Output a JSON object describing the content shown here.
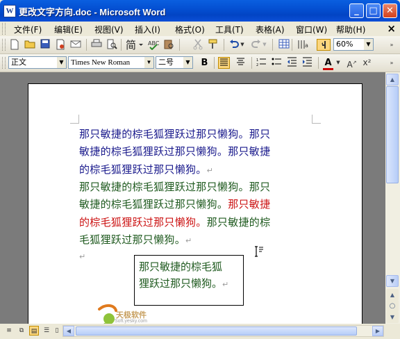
{
  "window": {
    "title": "更改文字方向.doc - Microsoft Word",
    "app_icon_label": "W",
    "minimize_glyph": "_",
    "maximize_glyph": "□",
    "close_glyph": "✕"
  },
  "menu": {
    "items": [
      "文件(F)",
      "编辑(E)",
      "视图(V)",
      "插入(I)",
      "格式(O)",
      "工具(T)",
      "表格(A)",
      "窗口(W)",
      "帮助(H)"
    ],
    "close_glyph": "×"
  },
  "standard_toolbar": {
    "zoom": "60%",
    "icons": [
      "new-icon",
      "open-icon",
      "save-icon",
      "permission-icon",
      "email-icon",
      "print-icon",
      "print-preview-icon",
      "research-icon",
      "spelling-icon",
      "cut-icon",
      "format-painter-icon",
      "undo-icon",
      "redo-icon",
      "table-icon",
      "columns-icon",
      "show-hide-icon"
    ]
  },
  "formatting_toolbar": {
    "style": "正文",
    "font": "Times New Roman",
    "size": "二号",
    "bold": "B",
    "font_color_label": "A",
    "font_color": "#cc0000",
    "grow_label": "A",
    "superscript_label": "x²"
  },
  "document": {
    "paragraph1": [
      "那只敏捷的棕毛狐狸跃过那只懒狗。那只",
      "敏捷的棕毛狐狸跃过那只懒狗。那只敏捷",
      "的棕毛狐狸跃过那只懒狗。"
    ],
    "paragraph2": {
      "line1": "那只敏捷的棕毛狐狸跃过那只懒狗。那只",
      "line2_normal": "敏捷的棕毛狐狸跃过那只懒狗。",
      "line2_red": "那只敏捷",
      "line3_red": "的棕毛狐狸跃过那只懒狗。",
      "line3_normal": "那只敏捷的棕",
      "line4": "毛狐狸跃过那只懒狗。"
    },
    "paragraph_mark": "↵",
    "textbox_lines": [
      "那只敏捷的棕毛狐",
      "狸跃过那只懒狗。"
    ],
    "colors": {
      "blue_text": "#1a1a8c",
      "green_text": "#1f5a1f",
      "red_text": "#cc1414"
    }
  },
  "watermark": {
    "brand": "天极软件",
    "url": "Soft.yesky.com"
  }
}
